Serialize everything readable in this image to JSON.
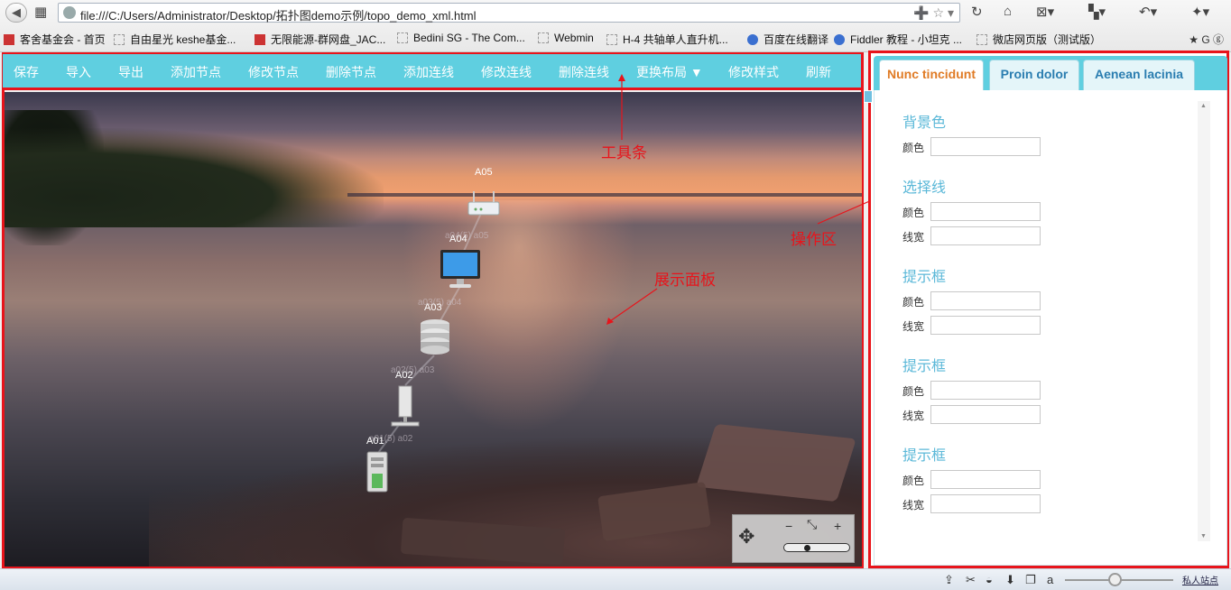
{
  "browser": {
    "url": "file:///C:/Users/Administrator/Desktop/拓扑图demo示例/topo_demo_xml.html",
    "bookmarks": [
      "客舍基金会 - 首页",
      "自由星光 keshe基金...",
      "无限能源-群网盘_JAC...",
      "Bedini SG - The Com...",
      "Webmin",
      "H-4 共轴单人直升机...",
      "百度在线翻译",
      "Fiddler 教程 - 小坦克 ...",
      "微店网页版（测试版）"
    ],
    "status_text": "私人站点"
  },
  "toolbar": {
    "items": [
      "保存",
      "导入",
      "导出",
      "添加节点",
      "修改节点",
      "删除节点",
      "添加连线",
      "修改连线",
      "删除连线",
      "更换布局 ▼",
      "修改样式",
      "刷新"
    ]
  },
  "topology": {
    "nodes": [
      {
        "id": "A05",
        "icon": "router-icon"
      },
      {
        "id": "A04",
        "icon": "monitor-icon"
      },
      {
        "id": "A03",
        "icon": "database-icon"
      },
      {
        "id": "A02",
        "icon": "server-tower-icon"
      },
      {
        "id": "A01",
        "icon": "pc-tower-icon"
      }
    ],
    "edges": [
      "a04(5) a05",
      "a03(5) a04",
      "a02(5) a03",
      "a01(5) a02"
    ]
  },
  "annotations": {
    "toolbar": "工具条",
    "canvas": "展示面板",
    "panel": "操作区"
  },
  "navigator": {
    "zoom_out": "−",
    "zoom_in": "+",
    "zoom_level": 0.35
  },
  "panel": {
    "tabs": [
      "Nunc tincidunt",
      "Proin dolor",
      "Aenean lacinia"
    ],
    "active_tab": "Nunc tincidunt",
    "sections": [
      {
        "title": "背景色",
        "fields": [
          "颜色"
        ]
      },
      {
        "title": "选择线",
        "fields": [
          "颜色",
          "线宽"
        ]
      },
      {
        "title": "提示框",
        "fields": [
          "颜色",
          "线宽"
        ]
      },
      {
        "title": "提示框",
        "fields": [
          "颜色",
          "线宽"
        ]
      },
      {
        "title": "提示框",
        "fields": [
          "颜色",
          "线宽"
        ]
      }
    ]
  },
  "colors": {
    "toolbar_bg": "#5fcfe0",
    "annotation_red": "#e8141b",
    "active_tab_text": "#e07b25",
    "tab_text": "#2a7db0",
    "section_title": "#5bb8d8"
  }
}
